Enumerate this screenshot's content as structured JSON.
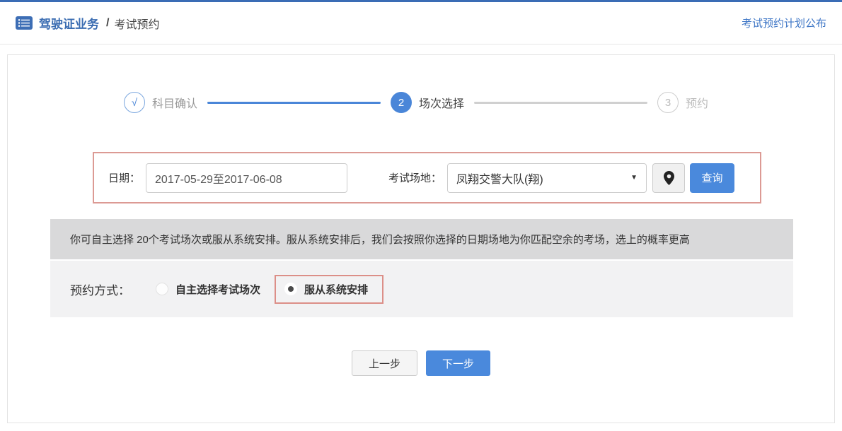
{
  "header": {
    "breadcrumb_main": "驾驶证业务",
    "breadcrumb_separator": "/",
    "breadcrumb_current": "考试预约",
    "plan_link_label": "考试预约计划公布"
  },
  "stepper": {
    "steps": [
      {
        "symbol": "√",
        "label": "科目确认",
        "state": "done"
      },
      {
        "symbol": "2",
        "label": "场次选择",
        "state": "active"
      },
      {
        "symbol": "3",
        "label": "预约",
        "state": "pending"
      }
    ]
  },
  "filter": {
    "date_label": "日期：",
    "date_value": "2017-05-29至2017-06-08",
    "venue_label": "考试场地：",
    "venue_selected": "凤翔交警大队(翔)",
    "search_button_label": "查询"
  },
  "icons": {
    "chevron_down": "▼"
  },
  "notice_text": "你可自主选择 20个考试场次或服从系统安排。服从系统安排后，我们会按照你选择的日期场地为你匹配空余的考场，选上的概率更高",
  "booking_method": {
    "label": "预约方式：",
    "options": [
      {
        "label": "自主选择考试场次",
        "selected": false
      },
      {
        "label": "服从系统安排",
        "selected": true
      }
    ]
  },
  "actions": {
    "prev_label": "上一步",
    "next_label": "下一步"
  },
  "colors": {
    "accent_blue": "#4a89dc",
    "top_line_blue": "#3a6cb5",
    "highlight_red_border": "#dc9a94",
    "notice_gray": "#d9d9da",
    "section_gray": "#f2f2f3"
  }
}
